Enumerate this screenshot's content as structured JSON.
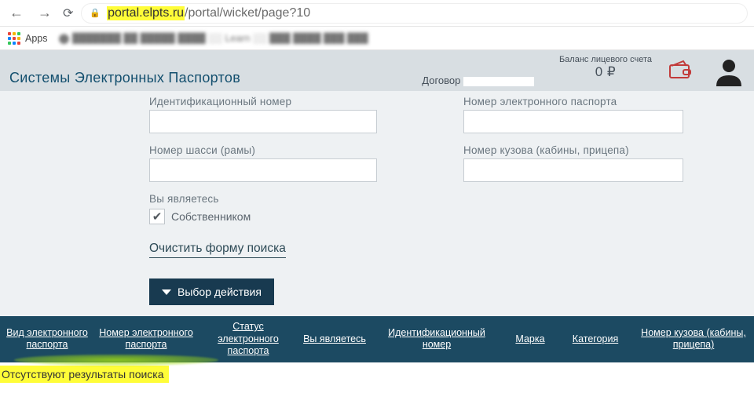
{
  "browser": {
    "url_host": "portal.elpts.ru",
    "url_path": "/portal/wicket/page?10"
  },
  "bookmarks": {
    "apps": "Apps"
  },
  "header": {
    "title": "Системы Электронных Паспортов",
    "balance_label": "Баланс лицевого счета",
    "balance_value": "0 ₽",
    "contract_label": "Договор"
  },
  "form": {
    "id_label": "Идентификационный номер",
    "epass_label": "Номер электронного паспорта",
    "chassis_label": "Номер шасси (рамы)",
    "body_label": "Номер кузова (кабины, прицепа)",
    "you_are_label": "Вы являетесь",
    "owner_label": "Собственником",
    "clear": "Очистить форму поиска"
  },
  "actions": {
    "choose": "Выбор действия"
  },
  "table": {
    "headers": {
      "kind": "Вид электронного паспорта",
      "num": "Номер электронного паспорта",
      "status": "Статус электронного паспорта",
      "you": "Вы являетесь",
      "idnum": "Идентификационный номер",
      "brand": "Марка",
      "cat": "Категория",
      "bodynum": "Номер кузова (кабины, прицепа)"
    },
    "no_results": "Отсутствуют результаты поиска"
  }
}
